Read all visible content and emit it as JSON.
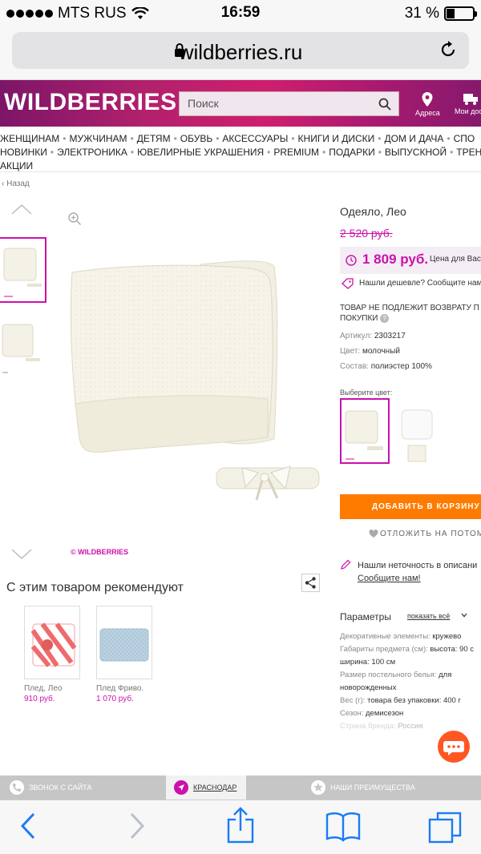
{
  "status_bar": {
    "carrier": "MTS RUS",
    "time": "16:59",
    "battery_percent": "31 %",
    "battery_level": 0.31
  },
  "browser": {
    "url": "wildberries.ru"
  },
  "site_header": {
    "logo": "WILDBERRIES",
    "search_placeholder": "Поиск",
    "addresses_label": "Адреса",
    "orders_label": "Мои дос"
  },
  "nav": {
    "row1": [
      "ЖЕНЩИНАМ",
      "МУЖЧИНАМ",
      "ДЕТЯМ",
      "ОБУВЬ",
      "АКСЕССУАРЫ",
      "КНИГИ И ДИСКИ",
      "ДОМ И ДАЧА",
      "СПО"
    ],
    "row2": [
      "НОВИНКИ",
      "ЭЛЕКТРОНИКА",
      "ЮВЕЛИРНЫЕ УКРАШЕНИЯ",
      "PREMIUM",
      "ПОДАРКИ",
      "ВЫПУСКНОЙ",
      "ТРЕН"
    ],
    "row3": [
      "АКЦИИ"
    ]
  },
  "back_label": "Назад",
  "gallery": {
    "watermark": "© WILDBERRIES"
  },
  "product": {
    "title": "Одеяло, Лео",
    "old_price": "2 520 руб.",
    "price": "1 809 руб.",
    "price_note": "Цена для Вас",
    "cheaper_link": "Нашли дешевле? Сообщите нам",
    "no_return_line1": "ТОВАР НЕ ПОДЛЕЖИТ ВОЗВРАТУ П",
    "no_return_line2": "ПОКУПКИ",
    "article_label": "Артикул:",
    "article_value": "2303217",
    "color_label": "Цвет:",
    "color_value": "молочный",
    "composition_label": "Состав:",
    "composition_value": "полиэстер 100%",
    "choose_color": "Выберите цвет:",
    "add_to_cart": "ДОБАВИТЬ В КОРЗИНУ",
    "postpone": "ОТЛОЖИТЬ НА ПОТОМ",
    "inaccuracy_line1": "Нашли неточность в описани",
    "inaccuracy_line2": "Сообщите нам!"
  },
  "params": {
    "title": "Параметры",
    "show_all": "показать всё",
    "rows": [
      {
        "k": "Декоративные элементы:",
        "v": "кружево"
      },
      {
        "k": "Габариты предмета (см):",
        "v": "высота: 90 с"
      },
      {
        "k": "",
        "v": "ширина: 100 см"
      },
      {
        "k": "Размер постельного белья:",
        "v": "для"
      },
      {
        "k": "",
        "v": "новорожденных"
      },
      {
        "k": "Вес (г):",
        "v": "товара без упаковки: 400 г"
      },
      {
        "k": "Сезон:",
        "v": "демисезон"
      },
      {
        "k": "Страна бренда:",
        "v": "Россия"
      }
    ]
  },
  "recommendations": {
    "title": "С этим товаром рекомендуют",
    "items": [
      {
        "name": "Плед, Лео",
        "price": "910 руб."
      },
      {
        "name": "Плед Фриво.",
        "price": "1 070 руб."
      }
    ]
  },
  "site_bottom_bar": {
    "call": "ЗВОНОК С САЙТА",
    "city": "КРАСНОДАР",
    "advantages": "НАШИ ПРЕИМУЩЕСТВА"
  },
  "colors": {
    "brand": "#cb11ab",
    "cta": "#ff7b00",
    "ios_blue": "#1a7cf5"
  }
}
